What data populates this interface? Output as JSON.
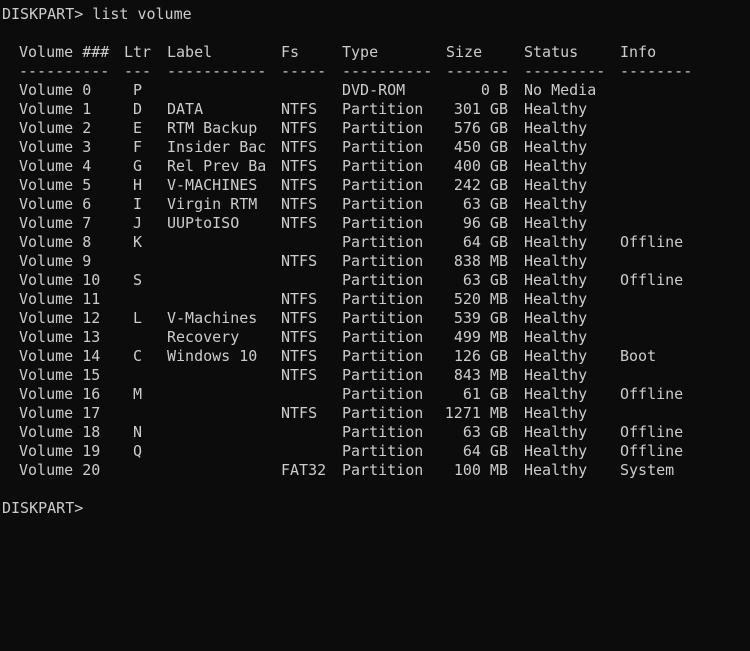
{
  "colors": {
    "background": "#0c0c0c",
    "foreground": "#cccccc"
  },
  "prompt_line": "DISKPART> list volume",
  "header": {
    "volume": "Volume ###",
    "ltr": "Ltr",
    "label": "Label",
    "fs": "Fs",
    "type": "Type",
    "size": "Size",
    "status": "Status",
    "info": "Info"
  },
  "separator": {
    "volume": "----------",
    "ltr": "---",
    "label": "-----------",
    "fs": "-----",
    "type": "----------",
    "size": "-------",
    "status": "---------",
    "info": "--------"
  },
  "volumes": [
    {
      "volume": "Volume 0",
      "ltr": "P",
      "label": "",
      "fs": "",
      "type": "DVD-ROM",
      "size": "0 B",
      "status": "No Media",
      "info": ""
    },
    {
      "volume": "Volume 1",
      "ltr": "D",
      "label": "DATA",
      "fs": "NTFS",
      "type": "Partition",
      "size": "301 GB",
      "status": "Healthy",
      "info": ""
    },
    {
      "volume": "Volume 2",
      "ltr": "E",
      "label": "RTM Backup",
      "fs": "NTFS",
      "type": "Partition",
      "size": "576 GB",
      "status": "Healthy",
      "info": ""
    },
    {
      "volume": "Volume 3",
      "ltr": "F",
      "label": "Insider Bac",
      "fs": "NTFS",
      "type": "Partition",
      "size": "450 GB",
      "status": "Healthy",
      "info": ""
    },
    {
      "volume": "Volume 4",
      "ltr": "G",
      "label": "Rel Prev Ba",
      "fs": "NTFS",
      "type": "Partition",
      "size": "400 GB",
      "status": "Healthy",
      "info": ""
    },
    {
      "volume": "Volume 5",
      "ltr": "H",
      "label": "V-MACHINES",
      "fs": "NTFS",
      "type": "Partition",
      "size": "242 GB",
      "status": "Healthy",
      "info": ""
    },
    {
      "volume": "Volume 6",
      "ltr": "I",
      "label": "Virgin RTM",
      "fs": "NTFS",
      "type": "Partition",
      "size": "63 GB",
      "status": "Healthy",
      "info": ""
    },
    {
      "volume": "Volume 7",
      "ltr": "J",
      "label": "UUPtoISO",
      "fs": "NTFS",
      "type": "Partition",
      "size": "96 GB",
      "status": "Healthy",
      "info": ""
    },
    {
      "volume": "Volume 8",
      "ltr": "K",
      "label": "",
      "fs": "",
      "type": "Partition",
      "size": "64 GB",
      "status": "Healthy",
      "info": "Offline"
    },
    {
      "volume": "Volume 9",
      "ltr": "",
      "label": "",
      "fs": "NTFS",
      "type": "Partition",
      "size": "838 MB",
      "status": "Healthy",
      "info": ""
    },
    {
      "volume": "Volume 10",
      "ltr": "S",
      "label": "",
      "fs": "",
      "type": "Partition",
      "size": "63 GB",
      "status": "Healthy",
      "info": "Offline"
    },
    {
      "volume": "Volume 11",
      "ltr": "",
      "label": "",
      "fs": "NTFS",
      "type": "Partition",
      "size": "520 MB",
      "status": "Healthy",
      "info": ""
    },
    {
      "volume": "Volume 12",
      "ltr": "L",
      "label": "V-Machines",
      "fs": "NTFS",
      "type": "Partition",
      "size": "539 GB",
      "status": "Healthy",
      "info": ""
    },
    {
      "volume": "Volume 13",
      "ltr": "",
      "label": "Recovery",
      "fs": "NTFS",
      "type": "Partition",
      "size": "499 MB",
      "status": "Healthy",
      "info": ""
    },
    {
      "volume": "Volume 14",
      "ltr": "C",
      "label": "Windows 10",
      "fs": "NTFS",
      "type": "Partition",
      "size": "126 GB",
      "status": "Healthy",
      "info": "Boot"
    },
    {
      "volume": "Volume 15",
      "ltr": "",
      "label": "",
      "fs": "NTFS",
      "type": "Partition",
      "size": "843 MB",
      "status": "Healthy",
      "info": ""
    },
    {
      "volume": "Volume 16",
      "ltr": "M",
      "label": "",
      "fs": "",
      "type": "Partition",
      "size": "61 GB",
      "status": "Healthy",
      "info": "Offline"
    },
    {
      "volume": "Volume 17",
      "ltr": "",
      "label": "",
      "fs": "NTFS",
      "type": "Partition",
      "size": "1271 MB",
      "status": "Healthy",
      "info": ""
    },
    {
      "volume": "Volume 18",
      "ltr": "N",
      "label": "",
      "fs": "",
      "type": "Partition",
      "size": "63 GB",
      "status": "Healthy",
      "info": "Offline"
    },
    {
      "volume": "Volume 19",
      "ltr": "Q",
      "label": "",
      "fs": "",
      "type": "Partition",
      "size": "64 GB",
      "status": "Healthy",
      "info": "Offline"
    },
    {
      "volume": "Volume 20",
      "ltr": "",
      "label": "",
      "fs": "FAT32",
      "type": "Partition",
      "size": "100 MB",
      "status": "Healthy",
      "info": "System"
    }
  ],
  "prompt_end": "DISKPART>"
}
